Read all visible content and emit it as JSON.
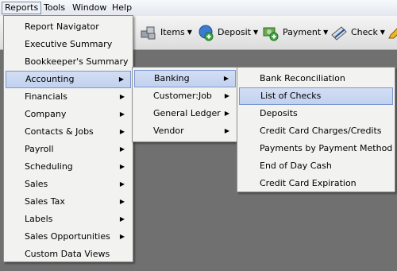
{
  "menubar": {
    "items": [
      {
        "label": "Reports"
      },
      {
        "label": "Tools"
      },
      {
        "label": "Window"
      },
      {
        "label": "Help"
      }
    ]
  },
  "toolbar": {
    "items": [
      {
        "label": "Items",
        "icon": "items-icon"
      },
      {
        "label": "Deposit",
        "icon": "deposit-icon"
      },
      {
        "label": "Payment",
        "icon": "payment-icon"
      },
      {
        "label": "Check",
        "icon": "check-icon"
      }
    ]
  },
  "reports_menu": {
    "items": [
      {
        "label": "Report Navigator"
      },
      {
        "label": "Executive Summary"
      },
      {
        "label": "Bookkeeper's Summary"
      },
      {
        "label": "Accounting"
      },
      {
        "label": "Financials"
      },
      {
        "label": "Company"
      },
      {
        "label": "Contacts & Jobs"
      },
      {
        "label": "Payroll"
      },
      {
        "label": "Scheduling"
      },
      {
        "label": "Sales"
      },
      {
        "label": "Sales Tax"
      },
      {
        "label": "Labels"
      },
      {
        "label": "Sales Opportunities"
      },
      {
        "label": "Custom Data Views"
      }
    ]
  },
  "accounting_menu": {
    "items": [
      {
        "label": "Banking"
      },
      {
        "label": "Customer:Job"
      },
      {
        "label": "General Ledger"
      },
      {
        "label": "Vendor"
      }
    ]
  },
  "banking_menu": {
    "items": [
      {
        "label": "Bank Reconciliation"
      },
      {
        "label": "List of Checks"
      },
      {
        "label": "Deposits"
      },
      {
        "label": "Credit Card Charges/Credits"
      },
      {
        "label": "Payments by Payment Method"
      },
      {
        "label": "End of Day Cash"
      },
      {
        "label": "Credit Card Expiration"
      }
    ]
  },
  "colors": {
    "highlight": "#c9d7f1",
    "highlight_border": "#7a97d1",
    "menu_bg": "#f2f2f0",
    "workspace_bg": "#707070"
  }
}
